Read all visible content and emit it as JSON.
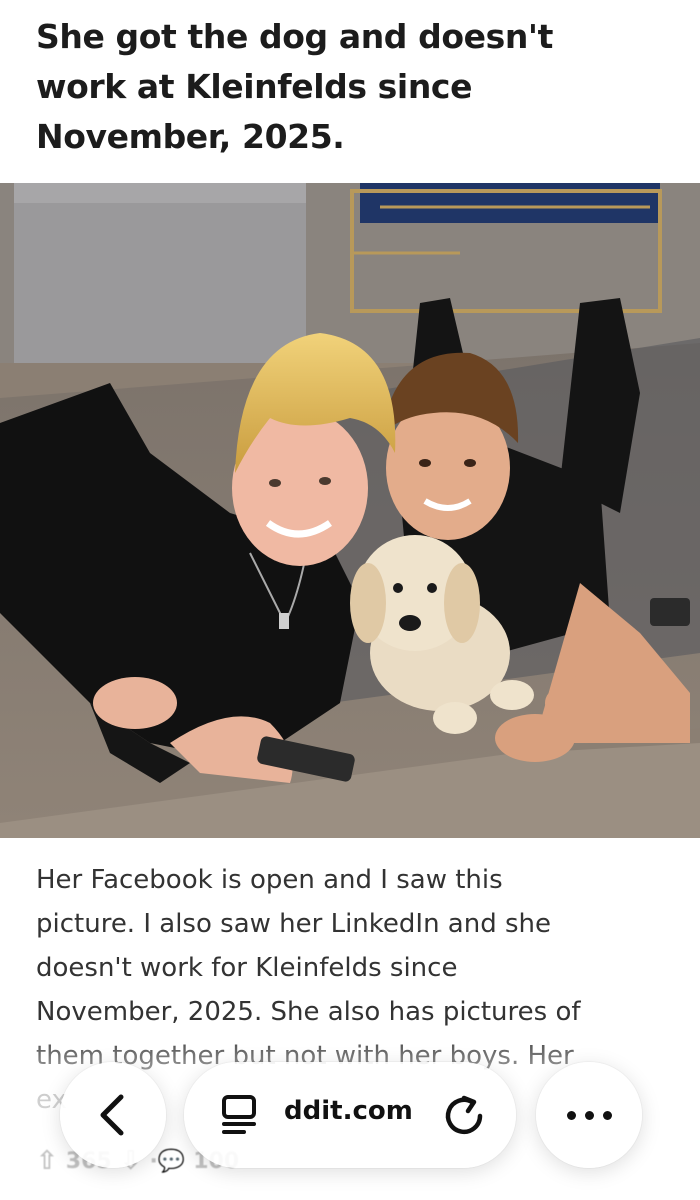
{
  "post": {
    "title": "She got the dog and doesn't\nwork at Kleinfelds since\nNovember, 2025.",
    "body": "Her Facebook is open and I saw this\npicture. I also saw her LinkedIn and she\ndoesn't work for Kleinfelds since\nNovember, 2025. She also has pictures of\nthem together but not with her boys. Her\nex",
    "photo_alt": "Two boys lying on a rug with a golden retriever puppy"
  },
  "votes": {
    "up_count": "365",
    "comment_count": "100"
  },
  "browser_bar": {
    "url": "ddit.com",
    "back_icon": "chevron-left-icon",
    "reader_icon": "reader-mode-icon",
    "reload_icon": "reload-icon",
    "more_icon": "more-dots-icon"
  },
  "colors": {
    "shirt": "#111111",
    "puppy": "#eadcc4",
    "floor": "#8d7e70"
  }
}
